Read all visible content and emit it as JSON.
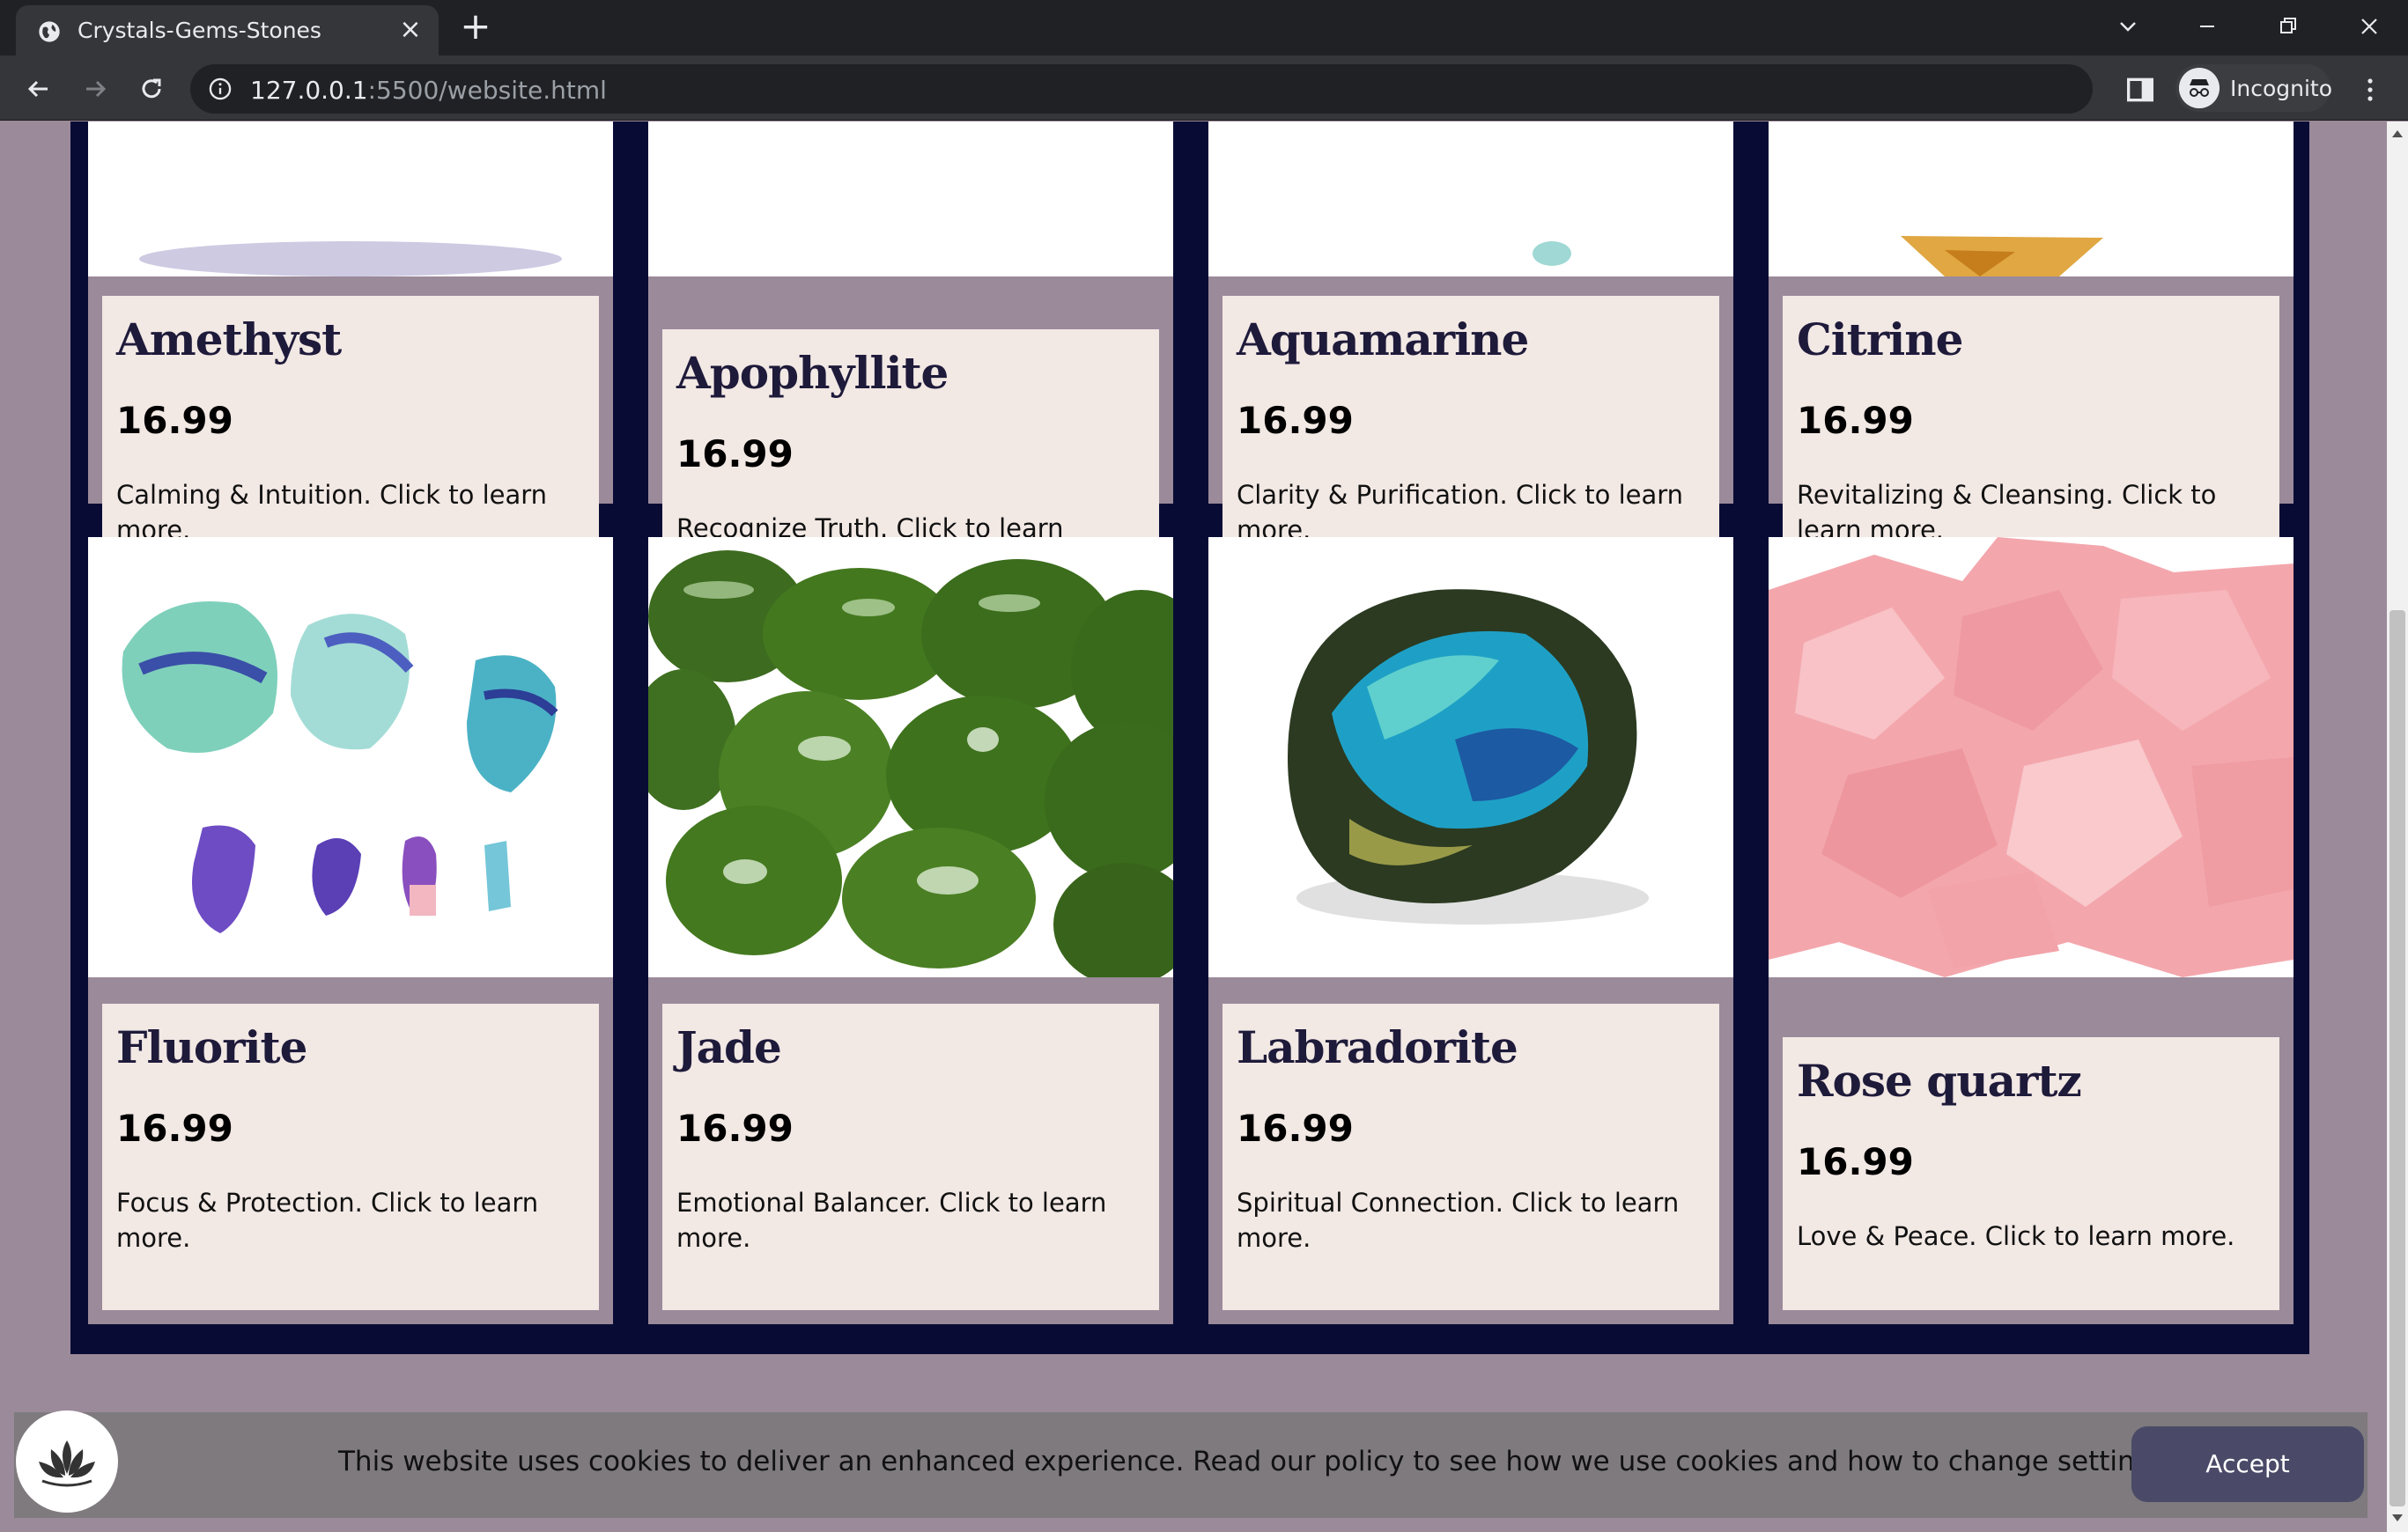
{
  "browser": {
    "tab_title": "Crystals-Gems-Stones",
    "url_host": "127.0.0.1",
    "url_rest": ":5500/website.html",
    "profile_label": "Incognito"
  },
  "page": {
    "products": [
      {
        "name": "Amethyst",
        "price": "16.99",
        "desc": "Calming & Intuition. Click to learn more."
      },
      {
        "name": "Apophyllite",
        "price": "16.99",
        "desc": "Recognize Truth. Click to learn more."
      },
      {
        "name": "Aquamarine",
        "price": "16.99",
        "desc": "Clarity & Purification. Click to learn more."
      },
      {
        "name": "Citrine",
        "price": "16.99",
        "desc": "Revitalizing & Cleansing. Click to learn more."
      },
      {
        "name": "Fluorite",
        "price": "16.99",
        "desc": "Focus & Protection. Click to learn more."
      },
      {
        "name": "Jade",
        "price": "16.99",
        "desc": "Emotional Balancer. Click to learn more."
      },
      {
        "name": "Labradorite",
        "price": "16.99",
        "desc": "Spiritual Connection. Click to learn more."
      },
      {
        "name": "Rose quartz",
        "price": "16.99",
        "desc": "Love & Peace. Click to learn more."
      }
    ],
    "cookie": {
      "message": "This website uses cookies to deliver an enhanced experience. Read our policy to see how we use cookies and how to change settings.",
      "accept_label": "Accept"
    }
  },
  "colors": {
    "page_bg": "#9b8a9a",
    "grid_bg": "#080c35",
    "card_body_bg": "#f2e8e4",
    "title_color": "#1e1a3a",
    "accept_bg": "#4a4a68"
  },
  "icons": {
    "tab_favicon": "globe-icon",
    "lotus": "lotus-icon"
  }
}
